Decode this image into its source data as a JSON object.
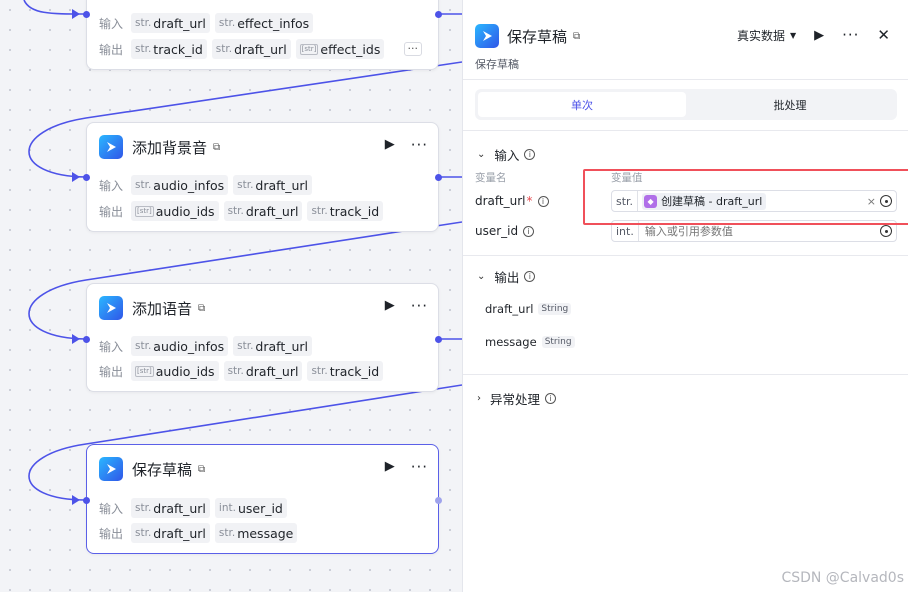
{
  "canvas": {
    "nodes": [
      {
        "title": "",
        "inputs_label": "输入",
        "outputs_label": "输出",
        "inputs": [
          {
            "type": "str.",
            "name": "draft_url"
          },
          {
            "type": "str.",
            "name": "effect_infos"
          }
        ],
        "outputs": [
          {
            "type": "str.",
            "name": "track_id"
          },
          {
            "type": "str.",
            "name": "draft_url"
          },
          {
            "type": "[str]",
            "name": "effect_ids"
          }
        ],
        "more": "···"
      },
      {
        "title": "添加背景音",
        "inputs_label": "输入",
        "outputs_label": "输出",
        "inputs": [
          {
            "type": "str.",
            "name": "audio_infos"
          },
          {
            "type": "str.",
            "name": "draft_url"
          }
        ],
        "outputs": [
          {
            "type": "[str]",
            "name": "audio_ids"
          },
          {
            "type": "str.",
            "name": "draft_url"
          },
          {
            "type": "str.",
            "name": "track_id"
          }
        ]
      },
      {
        "title": "添加语音",
        "inputs_label": "输入",
        "outputs_label": "输出",
        "inputs": [
          {
            "type": "str.",
            "name": "audio_infos"
          },
          {
            "type": "str.",
            "name": "draft_url"
          }
        ],
        "outputs": [
          {
            "type": "[str]",
            "name": "audio_ids"
          },
          {
            "type": "str.",
            "name": "draft_url"
          },
          {
            "type": "str.",
            "name": "track_id"
          }
        ]
      },
      {
        "title": "保存草稿",
        "inputs_label": "输入",
        "outputs_label": "输出",
        "inputs": [
          {
            "type": "str.",
            "name": "draft_url"
          },
          {
            "type": "int.",
            "name": "user_id"
          }
        ],
        "outputs": [
          {
            "type": "str.",
            "name": "draft_url"
          },
          {
            "type": "str.",
            "name": "message"
          }
        ]
      }
    ]
  },
  "panel": {
    "title": "保存草稿",
    "subtitle": "保存草稿",
    "mode_select": "真实数据",
    "tabs": [
      "单次",
      "批处理"
    ],
    "active_tab": 0,
    "input_section": "输入",
    "col_name": "变量名",
    "col_value": "变量值",
    "params": [
      {
        "name": "draft_url",
        "required": true,
        "type": "str.",
        "ref_node": "创建草稿",
        "ref_sep": " - ",
        "ref_field": "draft_url"
      },
      {
        "name": "user_id",
        "required": false,
        "type": "int.",
        "placeholder": "输入或引用参数值"
      }
    ],
    "output_section": "输出",
    "outputs": [
      {
        "name": "draft_url",
        "type": "String"
      },
      {
        "name": "message",
        "type": "String"
      }
    ],
    "error_section": "异常处理"
  },
  "colors": {
    "accent": "#4d53e8",
    "highlight": "#f0505a",
    "app_icon": "#2a8ef5",
    "ref_icon": "#b06fe8"
  },
  "watermark": "CSDN @Calvad0s"
}
